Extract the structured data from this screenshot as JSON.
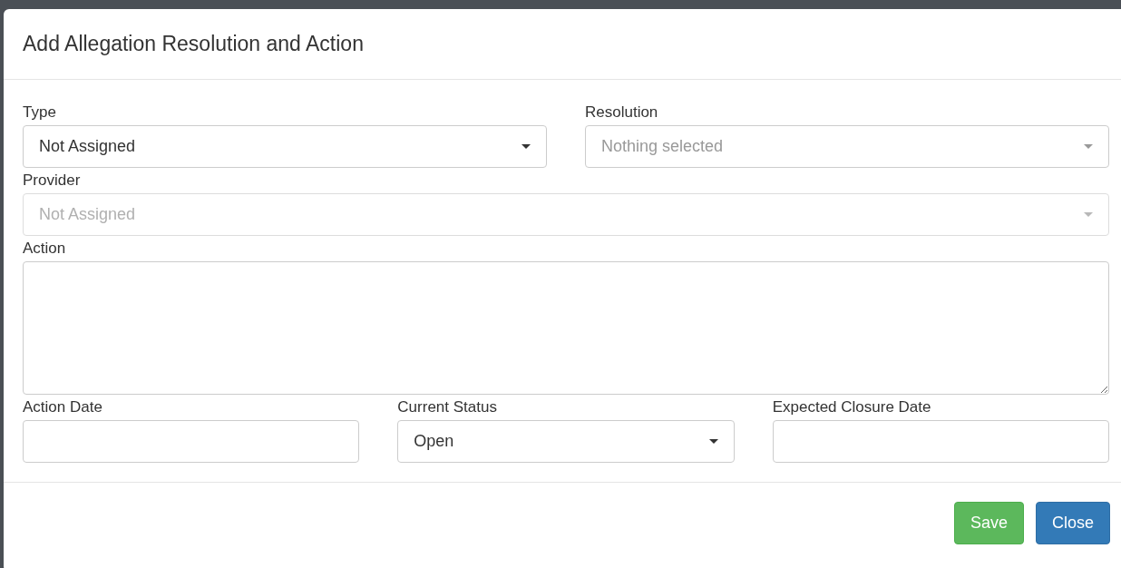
{
  "dialog": {
    "title": "Add Allegation Resolution and Action"
  },
  "rows": [
    {
      "fields": [
        {
          "kind": "select",
          "label": "Type",
          "value": "Not Assigned",
          "disabled": false
        },
        {
          "kind": "select",
          "label": "Resolution",
          "placeholder": "Nothing selected",
          "disabled": false
        }
      ]
    },
    {
      "fields": [
        {
          "kind": "select",
          "label": "Provider",
          "value": "Not Assigned",
          "disabled": true
        }
      ]
    },
    {
      "fields": [
        {
          "kind": "textarea",
          "label": "Action"
        }
      ]
    },
    {
      "fields": [
        {
          "kind": "input",
          "label": "Action Date"
        },
        {
          "kind": "select",
          "label": "Current Status",
          "value": "Open",
          "disabled": false
        },
        {
          "kind": "input",
          "label": "Expected Closure Date"
        }
      ]
    }
  ],
  "buttons": [
    {
      "label": "Save",
      "kind": "success"
    },
    {
      "label": "Close",
      "kind": "primary"
    }
  ]
}
